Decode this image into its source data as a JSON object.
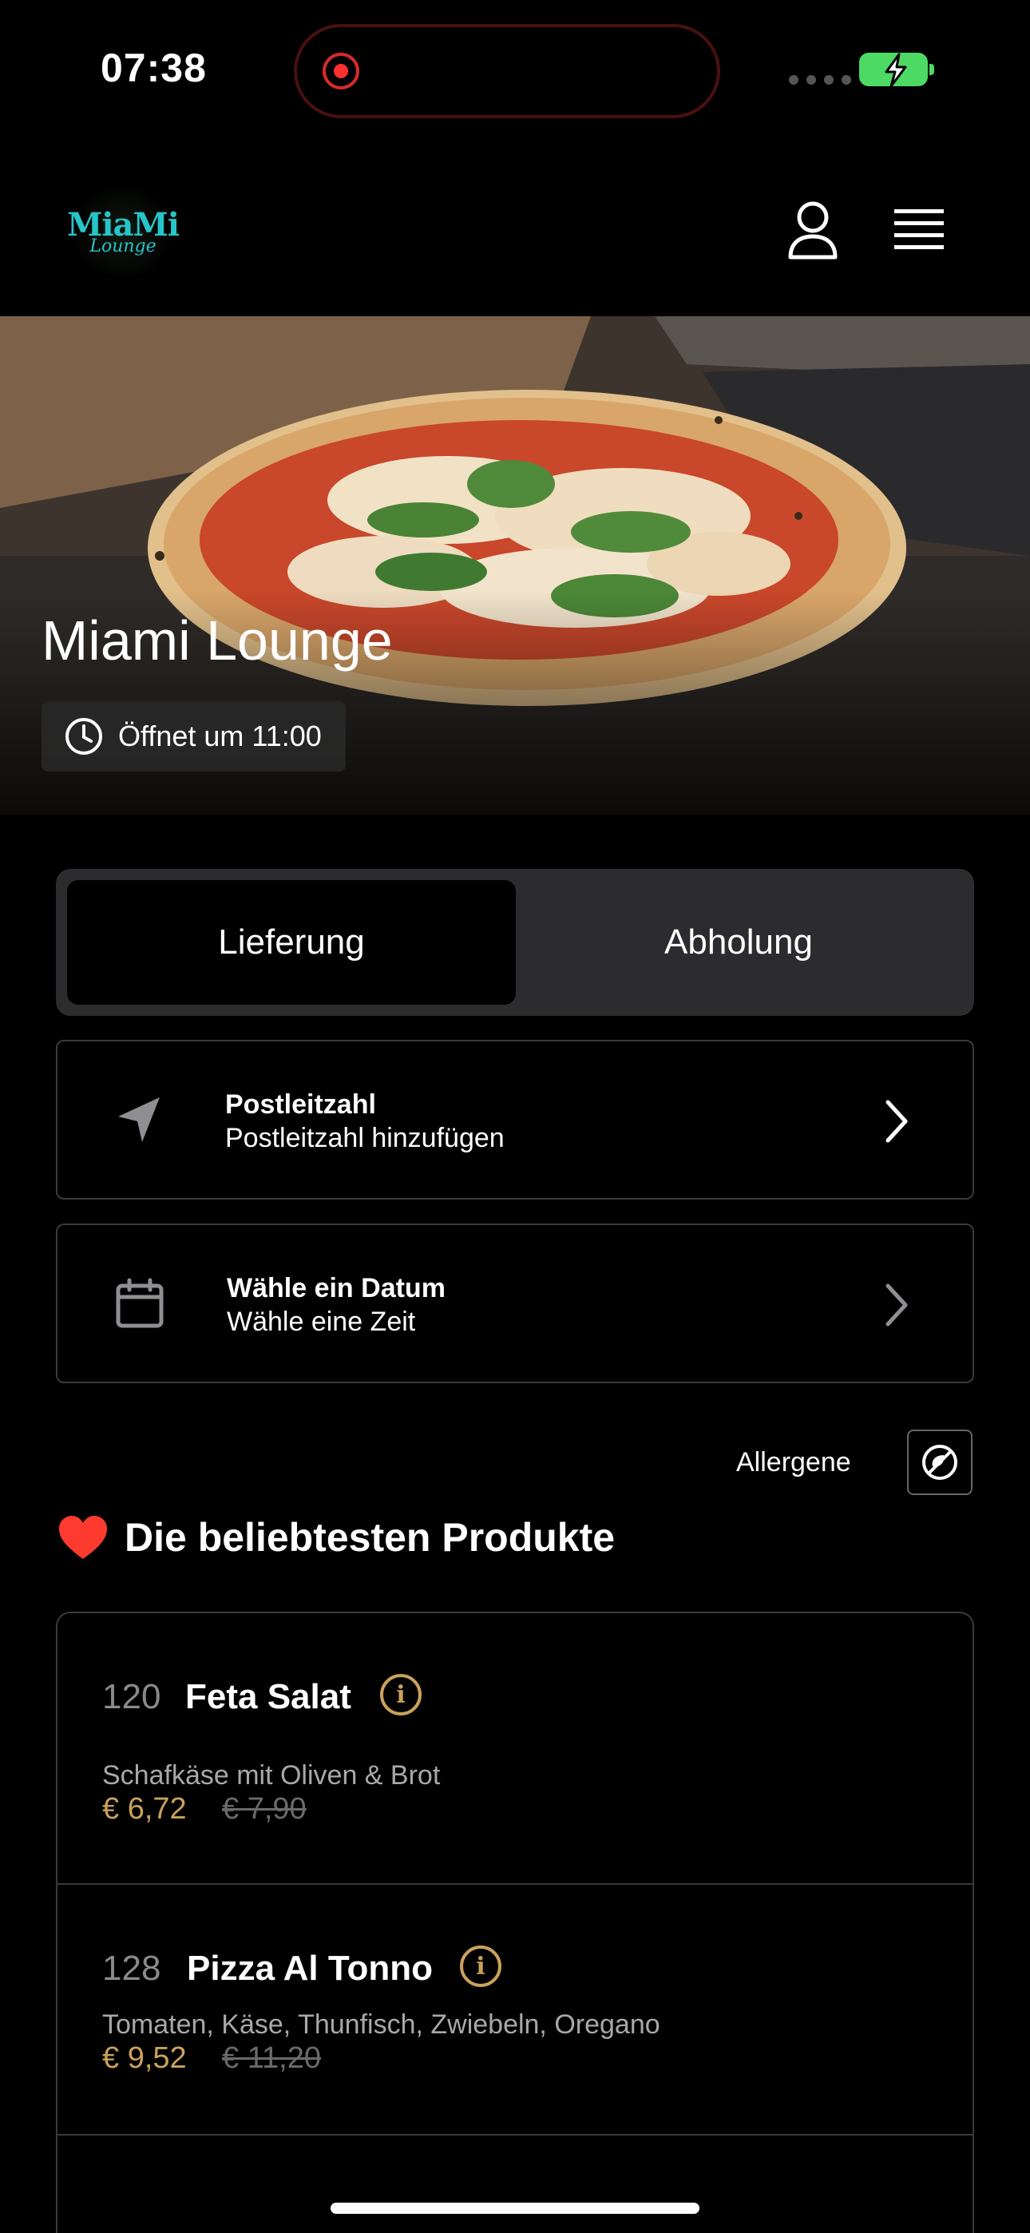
{
  "status": {
    "time": "07:38"
  },
  "brand": {
    "logo_line1": "MiaMi",
    "logo_line2": "Lounge"
  },
  "hero": {
    "title": "Miami Lounge",
    "hours": "Öffnet um 11:00"
  },
  "mode_toggle": {
    "delivery": "Lieferung",
    "pickup": "Abholung",
    "selected": "Lieferung"
  },
  "postcode": {
    "title": "Postleitzahl",
    "subtitle": "Postleitzahl hinzufügen"
  },
  "schedule": {
    "title": "Wähle ein Datum",
    "subtitle": "Wähle eine Zeit"
  },
  "allergens": {
    "label": "Allergene"
  },
  "popular": {
    "heading": "Die beliebtesten Produkte",
    "products": [
      {
        "number": "120",
        "name": "Feta Salat",
        "description": "Schafkäse mit Oliven & Brot",
        "price": "€ 6,72",
        "old_price": "€ 7,90"
      },
      {
        "number": "128",
        "name": "Pizza Al Tonno",
        "description": "Tomaten, Käse, Thunfisch, Zwiebeln, Oregano",
        "price": "€ 9,52",
        "old_price": "€ 11,20"
      }
    ]
  },
  "colors": {
    "accent_gold": "#c9a25a",
    "logo_teal": "#27c4c8",
    "battery_green": "#4cd964",
    "record_red": "#ff3030"
  }
}
